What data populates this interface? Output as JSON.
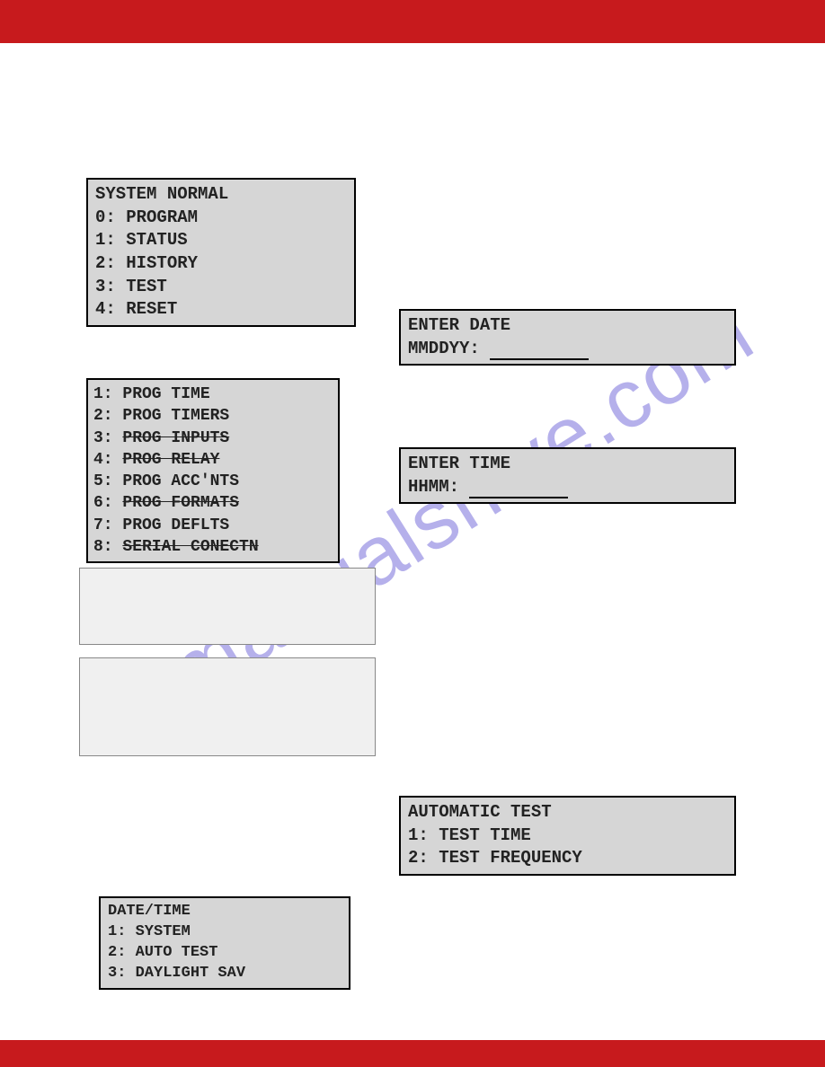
{
  "watermark": "manualshive.com",
  "panels": {
    "system_normal": {
      "title": "SYSTEM NORMAL",
      "items": [
        "0: PROGRAM",
        "1: STATUS",
        "2: HISTORY",
        "3: TEST",
        "4: RESET"
      ]
    },
    "prog_menu": {
      "items": [
        {
          "text": "1: PROG TIME",
          "strike": false
        },
        {
          "text": "2: PROG TIMERS",
          "strike": false
        },
        {
          "text": "3: PROG INPUTS",
          "strike": true,
          "prefix": "3: "
        },
        {
          "text": "4: PROG RELAY",
          "strike": true,
          "prefix": "4: "
        },
        {
          "text": "5: PROG ACC'NTS",
          "strike": false
        },
        {
          "text": "6: PROG FORMATS",
          "strike": true,
          "prefix": "6: "
        },
        {
          "text": "7: PROG DEFLTS",
          "strike": false
        },
        {
          "text": "8: SERIAL CONECTN",
          "strike": true,
          "prefix": "8: "
        }
      ]
    },
    "enter_date": {
      "title": "ENTER DATE",
      "label": "MMDDYY:"
    },
    "enter_time": {
      "title": "ENTER TIME",
      "label": "HHMM:"
    },
    "auto_test": {
      "title": "AUTOMATIC TEST",
      "items": [
        "1: TEST TIME",
        "2: TEST FREQUENCY"
      ]
    },
    "date_time": {
      "title": "DATE/TIME",
      "items": [
        "1: SYSTEM",
        "2: AUTO TEST",
        "3: DAYLIGHT SAV"
      ]
    }
  }
}
